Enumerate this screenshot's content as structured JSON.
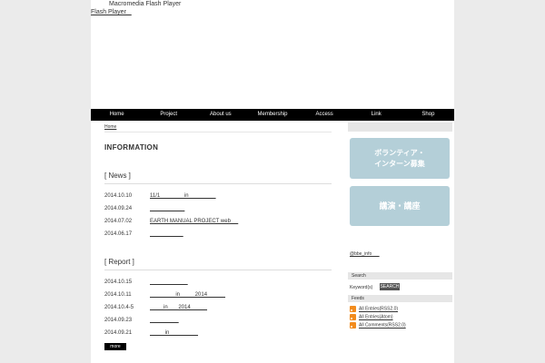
{
  "flash": {
    "title": "Macromedia Flash Player",
    "link": "Flash Player   "
  },
  "nav": [
    "Home",
    "Project",
    "About us",
    "Membership",
    "Access",
    "Link",
    "Shop"
  ],
  "breadcrumb": "Home",
  "info_title": "INFORMATION",
  "news": {
    "title": "[ News ]",
    "entries": [
      {
        "date": "2014.10.10",
        "text": "11/1                in                  "
      },
      {
        "date": "2014.09.24",
        "text": "                       "
      },
      {
        "date": "2014.07.02",
        "text": "EARTH MANUAL PROJECT web     "
      },
      {
        "date": "2014.06.17",
        "text": "                      "
      }
    ]
  },
  "report": {
    "title": "[ Report ]",
    "entries": [
      {
        "date": "2014.10.15",
        "text": "                         "
      },
      {
        "date": "2014.10.11",
        "text": "                 in          2014            "
      },
      {
        "date": "2014.10.4-5",
        "text": "         in       2014           "
      },
      {
        "date": "2014.09.23",
        "text": "                   "
      },
      {
        "date": "2014.09.21",
        "text": "          in                   "
      }
    ]
  },
  "more_label": "more",
  "sidebar": {
    "banner1_line1": "ボランティア・",
    "banner1_line2": "インターン募集",
    "banner2": "講演・講座",
    "twitter_link": "@bbe_info      ",
    "search_head": "Search",
    "keyword_label": "Keyword(s)",
    "search_button": "SEARCH",
    "feeds_head": "Feeds",
    "feeds": [
      "All Entries(RSS2.0)",
      "All Entries(Atom)",
      "All Comments(RSS2.0)"
    ]
  }
}
